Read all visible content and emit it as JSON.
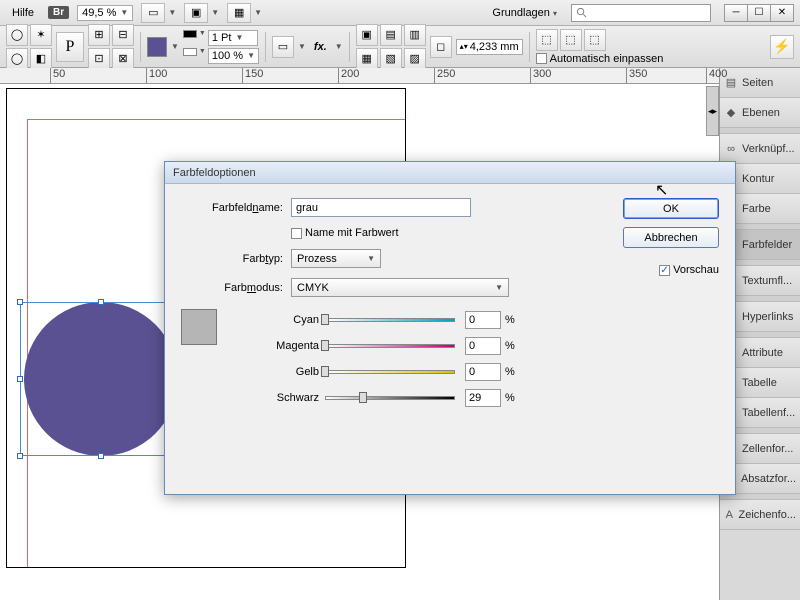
{
  "menu": {
    "help": "Hilfe",
    "br": "Br",
    "zoom": "49,5 %",
    "workspace": "Grundlagen"
  },
  "toolbar": {
    "stroke_weight": "1 Pt",
    "opacity": "100 %",
    "fx": "fx.",
    "measure": "4,233 mm",
    "autofit": "Automatisch einpassen"
  },
  "ruler": {
    "ticks": [
      "50",
      "100",
      "150",
      "200",
      "250",
      "300",
      "350",
      "400"
    ]
  },
  "panels": {
    "items": [
      {
        "label": "Seiten",
        "icon": "▤"
      },
      {
        "label": "Ebenen",
        "icon": "◆"
      },
      {
        "label": "Verknüpf...",
        "icon": "∞"
      },
      {
        "label": "Kontur",
        "icon": "≡"
      },
      {
        "label": "Farbe",
        "icon": "◧"
      },
      {
        "label": "Farbfelder",
        "icon": "▦",
        "sel": true
      },
      {
        "label": "Textumfl...",
        "icon": "▣"
      },
      {
        "label": "Hyperlinks",
        "icon": "⎘"
      },
      {
        "label": "Attribute",
        "icon": "⊠"
      },
      {
        "label": "Tabelle",
        "icon": "⊞"
      },
      {
        "label": "Tabellenf...",
        "icon": "⊞"
      },
      {
        "label": "Zellenfor...",
        "icon": "▭"
      },
      {
        "label": "Absatzfor...",
        "icon": "¶"
      },
      {
        "label": "Zeichenfo...",
        "icon": "A"
      }
    ]
  },
  "dialog": {
    "title": "Farbfeldoptionen",
    "labels": {
      "name": "Farbfeldname:",
      "name_with_value": "Name mit Farbwert",
      "color_type": "Farbtyp:",
      "color_mode": "Farbmodus:",
      "cyan": "Cyan",
      "magenta": "Magenta",
      "yellow": "Gelb",
      "black": "Schwarz",
      "pct": "%"
    },
    "values": {
      "name": "grau",
      "name_with_value_checked": false,
      "color_type": "Prozess",
      "color_mode": "CMYK",
      "cyan": "0",
      "magenta": "0",
      "yellow": "0",
      "black": "29"
    },
    "buttons": {
      "ok": "OK",
      "cancel": "Abbrechen"
    },
    "preview_label": "Vorschau",
    "preview_checked": true
  }
}
